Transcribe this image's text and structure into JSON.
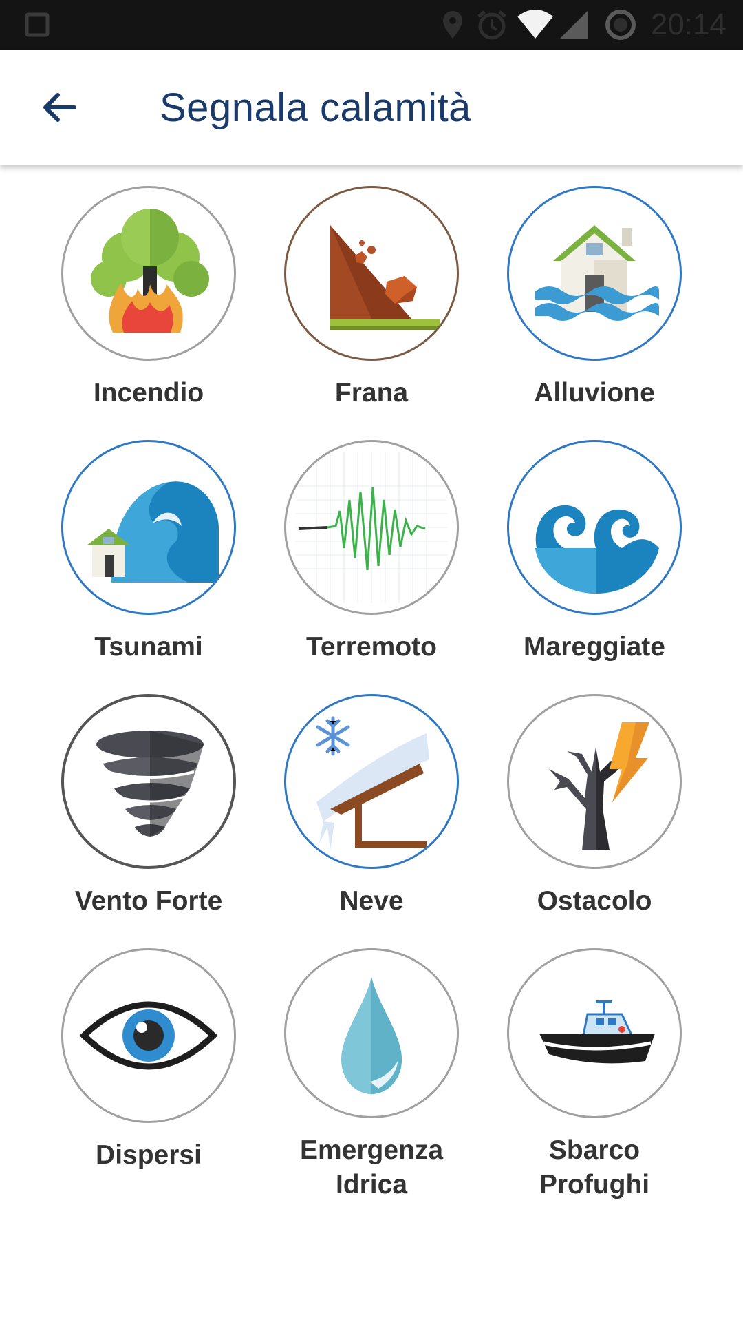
{
  "status_bar": {
    "time": "20:14",
    "icons": [
      "square-icon",
      "location-icon",
      "alarm-icon",
      "wifi-icon",
      "signal-icon",
      "battery-icon"
    ]
  },
  "header": {
    "back_icon": "arrow-left-icon",
    "title": "Segnala calamità"
  },
  "colors": {
    "title": "#1a3a6a",
    "label": "#333333",
    "ring_gray": "#9e9e9e",
    "ring_blue": "#2f78c4",
    "ring_brown": "#7b5a44",
    "ring_dark": "#555555"
  },
  "categories": [
    {
      "label": "Incendio",
      "icon": "fire-tree-icon"
    },
    {
      "label": "Frana",
      "icon": "landslide-icon"
    },
    {
      "label": "Alluvione",
      "icon": "flood-house-icon"
    },
    {
      "label": "Tsunami",
      "icon": "tsunami-wave-icon"
    },
    {
      "label": "Terremoto",
      "icon": "seismograph-icon"
    },
    {
      "label": "Mareggiate",
      "icon": "sea-storm-icon"
    },
    {
      "label": "Vento Forte",
      "icon": "tornado-icon"
    },
    {
      "label": "Neve",
      "icon": "snow-roof-icon"
    },
    {
      "label": "Ostacolo",
      "icon": "lightning-tree-icon"
    },
    {
      "label": "Dispersi",
      "icon": "eye-icon"
    },
    {
      "label": "Emergenza Idrica",
      "icon": "water-drop-icon"
    },
    {
      "label": "Sbarco Profughi",
      "icon": "rescue-boat-icon"
    }
  ]
}
